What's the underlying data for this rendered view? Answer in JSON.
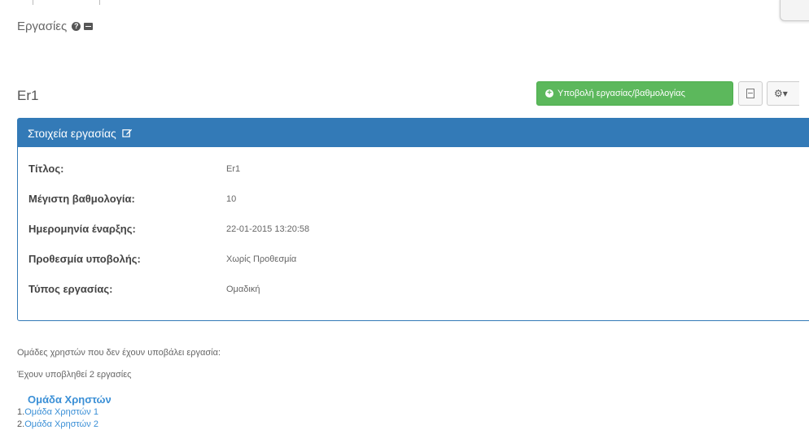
{
  "header": {
    "section_title": "Εργασίες"
  },
  "assignment": {
    "title": "Er1"
  },
  "actions": {
    "submit_label": "Υποβολή εργασίας/βαθμολογίας",
    "settings_glyph": "⚙▾"
  },
  "panel": {
    "heading": "Στοιχεία εργασίας",
    "rows": [
      {
        "label": "Τίτλος:",
        "value": "Er1"
      },
      {
        "label": "Μέγιστη βαθμολογία:",
        "value": "10"
      },
      {
        "label": "Ημερομηνία έναρξης:",
        "value": "22-01-2015 13:20:58"
      },
      {
        "label": "Προθεσμία υποβολής:",
        "value": "Χωρίς Προθεσμία"
      },
      {
        "label": "Τύπος εργασίας:",
        "value": "Ομαδική"
      }
    ]
  },
  "groups_note": "Ομάδες χρηστών που δεν έχουν υποβάλει εργασία:",
  "submitted_count": "Έχουν υποβληθεί 2 εργασίες",
  "group_table": {
    "heading": "Ομάδα Χρηστών",
    "items": [
      {
        "num": "1.",
        "name": "Ομάδα Χρηστών 1"
      },
      {
        "num": "2.",
        "name": "Ομάδα Χρηστών 2"
      }
    ]
  },
  "colors": {
    "panel_blue": "#337ab7",
    "success_green": "#5cb85c",
    "link_blue": "#3a8fd6"
  },
  "icons": [
    "help-icon",
    "minimize-icon",
    "plus-circle-icon",
    "document-icon",
    "gear-icon",
    "edit-icon"
  ]
}
